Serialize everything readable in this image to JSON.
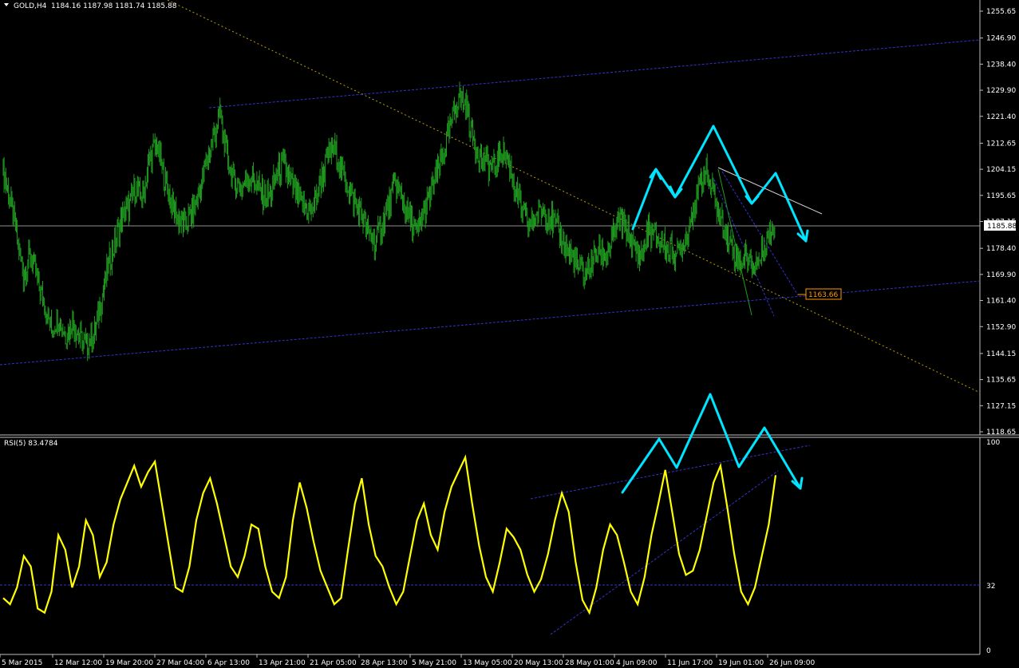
{
  "chart_header": {
    "symbol_label": "GOLD,H4",
    "ohlc": "1184.16 1187.98 1181.74 1185.88"
  },
  "current_price_label": "1185.88",
  "level_label": "1163.66",
  "price_axis_ticks": [
    "1255.65",
    "1246.90",
    "1238.40",
    "1229.90",
    "1221.40",
    "1212.65",
    "1204.15",
    "1195.65",
    "1187.15",
    "1178.40",
    "1169.90",
    "1161.40",
    "1152.90",
    "1144.15",
    "1135.65",
    "1127.15",
    "1118.65"
  ],
  "time_axis_labels": [
    "5 Mar 2015",
    "12 Mar 12:00",
    "19 Mar 20:00",
    "27 Mar 04:00",
    "6 Apr 13:00",
    "13 Apr 21:00",
    "21 Apr 05:00",
    "28 Apr 13:00",
    "5 May 21:00",
    "13 May 05:00",
    "20 May 13:00",
    "28 May 01:00",
    "4 Jun 09:00",
    "11 Jun 17:00",
    "19 Jun 01:00",
    "26 Jun 09:00"
  ],
  "rsi_header": "RSI(5) 83.4784",
  "rsi_ticks": [
    "100",
    "32",
    "0"
  ],
  "colors": {
    "background": "#000000",
    "candles": "#1f9d1f",
    "rsi_line": "#ffff00",
    "arrows": "#00e5ff",
    "channel": "#3333cc",
    "trend_dashed": "#b8a000",
    "axis": "#c0c0c0",
    "level_box": "#ff9900"
  },
  "chart_data": [
    {
      "type": "candlestick",
      "title": "GOLD,H4",
      "ylim": [
        1118.65,
        1255.65
      ],
      "close_series": [
        1205,
        1195,
        1183,
        1170,
        1176,
        1168,
        1160,
        1152,
        1156,
        1150,
        1155,
        1149,
        1147,
        1150,
        1160,
        1172,
        1180,
        1188,
        1192,
        1198,
        1195,
        1208,
        1212,
        1202,
        1194,
        1188,
        1186,
        1190,
        1196,
        1206,
        1214,
        1222,
        1208,
        1200,
        1198,
        1202,
        1200,
        1196,
        1195,
        1202,
        1206,
        1200,
        1195,
        1192,
        1190,
        1198,
        1205,
        1212,
        1206,
        1200,
        1194,
        1190,
        1184,
        1180,
        1186,
        1192,
        1200,
        1194,
        1188,
        1183,
        1190,
        1196,
        1204,
        1210,
        1220,
        1228,
        1225,
        1215,
        1208,
        1206,
        1204,
        1210,
        1208,
        1198,
        1190,
        1186,
        1188,
        1192,
        1188,
        1185,
        1180,
        1176,
        1172,
        1170,
        1174,
        1178,
        1176,
        1182,
        1188,
        1184,
        1178,
        1176,
        1184,
        1182,
        1180,
        1178,
        1176,
        1180,
        1188,
        1196,
        1204,
        1198,
        1190,
        1184,
        1178,
        1174,
        1176,
        1172,
        1176,
        1182,
        1186
      ],
      "current_price": 1185.88,
      "level": 1163.66
    },
    {
      "type": "line",
      "title": "RSI(5) 83.4784",
      "ylim": [
        0,
        100
      ],
      "reference_level": 32,
      "values": [
        25,
        22,
        30,
        45,
        40,
        20,
        18,
        28,
        55,
        48,
        30,
        40,
        62,
        55,
        35,
        42,
        60,
        72,
        80,
        88,
        78,
        85,
        90,
        70,
        50,
        30,
        28,
        40,
        62,
        75,
        82,
        70,
        55,
        40,
        35,
        45,
        60,
        58,
        40,
        28,
        25,
        35,
        62,
        80,
        68,
        52,
        38,
        30,
        22,
        25,
        48,
        70,
        82,
        60,
        45,
        40,
        30,
        22,
        28,
        45,
        62,
        70,
        55,
        48,
        66,
        78,
        85,
        92,
        70,
        50,
        35,
        28,
        42,
        58,
        54,
        48,
        36,
        28,
        34,
        46,
        62,
        75,
        66,
        42,
        24,
        18,
        30,
        48,
        60,
        55,
        42,
        28,
        22,
        35,
        55,
        70,
        86,
        66,
        46,
        36,
        38,
        48,
        64,
        80,
        88,
        68,
        46,
        28,
        22,
        30,
        45,
        60,
        83.48
      ]
    }
  ]
}
